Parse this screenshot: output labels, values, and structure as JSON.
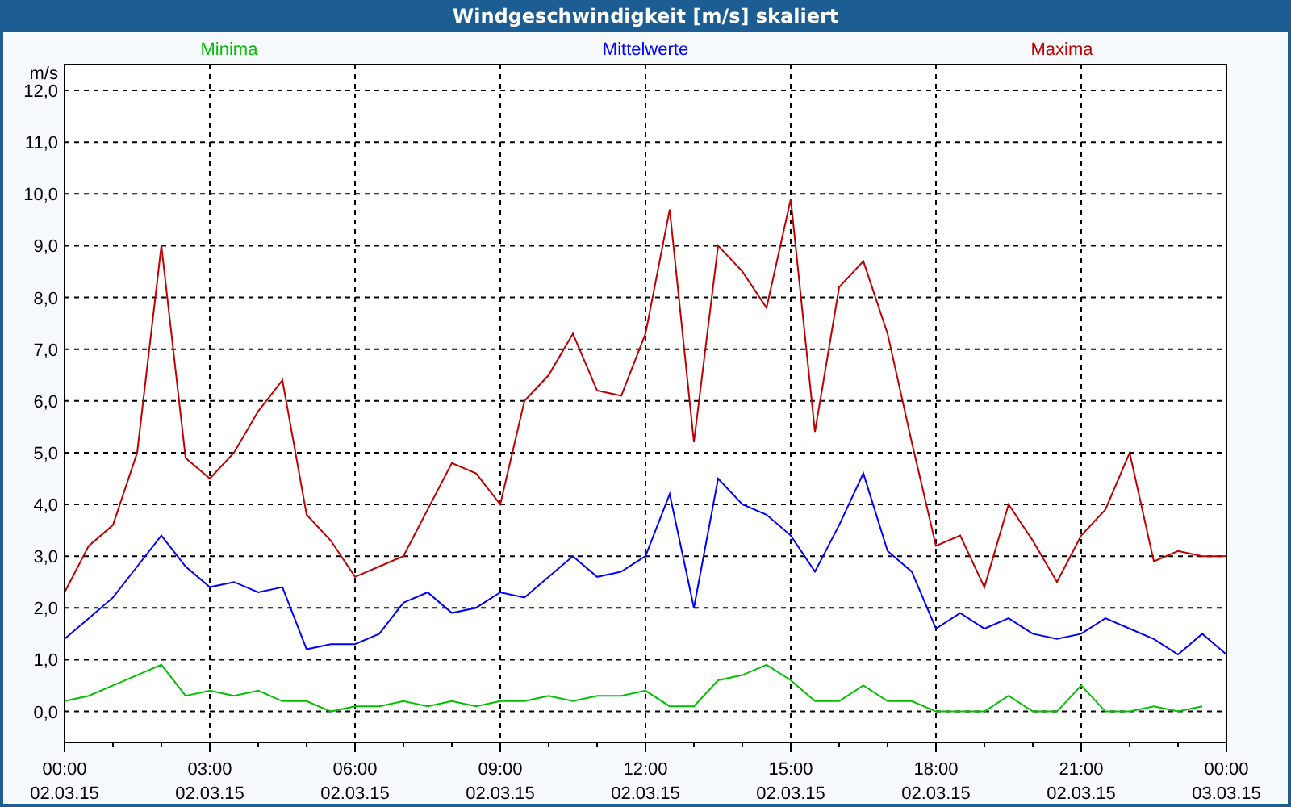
{
  "window": {
    "title": "Windgeschwindigkeit [m/s] skaliert"
  },
  "chart": {
    "unit_label": "m/s",
    "date_labels": [
      "02.03.15",
      "02.03.15",
      "02.03.15",
      "02.03.15",
      "02.03.15",
      "02.03.15",
      "02.03.15",
      "02.03.15",
      "03.03.15"
    ],
    "chart_data": {
      "type": "line",
      "grid": true,
      "xlim": [
        0,
        24
      ],
      "ylim": [
        -0.6,
        12.5
      ],
      "xticks": [
        {
          "value": 0,
          "label": "00:00"
        },
        {
          "value": 3,
          "label": "03:00"
        },
        {
          "value": 6,
          "label": "06:00"
        },
        {
          "value": 9,
          "label": "09:00"
        },
        {
          "value": 12,
          "label": "12:00"
        },
        {
          "value": 15,
          "label": "15:00"
        },
        {
          "value": 18,
          "label": "18:00"
        },
        {
          "value": 21,
          "label": "21:00"
        },
        {
          "value": 24,
          "label": "00:00"
        }
      ],
      "yticks": [
        {
          "value": 0,
          "label": "0,0"
        },
        {
          "value": 1,
          "label": "1,0"
        },
        {
          "value": 2,
          "label": "2,0"
        },
        {
          "value": 3,
          "label": "3,0"
        },
        {
          "value": 4,
          "label": "4,0"
        },
        {
          "value": 5,
          "label": "5,0"
        },
        {
          "value": 6,
          "label": "6,0"
        },
        {
          "value": 7,
          "label": "7,0"
        },
        {
          "value": 8,
          "label": "8,0"
        },
        {
          "value": 9,
          "label": "9,0"
        },
        {
          "value": 10,
          "label": "10,0"
        },
        {
          "value": 11,
          "label": "11,0"
        },
        {
          "value": 12,
          "label": "12,0"
        }
      ],
      "x": [
        0,
        0.5,
        1,
        1.5,
        2,
        2.5,
        3,
        3.5,
        4,
        4.5,
        5,
        5.5,
        6,
        6.5,
        7,
        7.5,
        8,
        8.5,
        9,
        9.5,
        10,
        10.5,
        11,
        11.5,
        12,
        12.5,
        13,
        13.5,
        14,
        14.5,
        15,
        15.5,
        16,
        16.5,
        17,
        17.5,
        18,
        18.5,
        19,
        19.5,
        20,
        20.5,
        21,
        21.5,
        22,
        22.5,
        23,
        23.5,
        24
      ],
      "series": [
        {
          "name": "Minima",
          "color": "#00c000",
          "values": [
            0.2,
            0.3,
            0.5,
            0.7,
            0.9,
            0.3,
            0.4,
            0.3,
            0.4,
            0.2,
            0.2,
            0.0,
            0.1,
            0.1,
            0.2,
            0.1,
            0.2,
            0.1,
            0.2,
            0.2,
            0.3,
            0.2,
            0.3,
            0.3,
            0.4,
            0.1,
            0.1,
            0.6,
            0.7,
            0.9,
            0.6,
            0.2,
            0.2,
            0.5,
            0.2,
            0.2,
            0.0,
            0.0,
            0.0,
            0.3,
            0.0,
            0.0,
            0.5,
            0.0,
            0.0,
            0.1,
            0.0,
            0.1,
            null
          ]
        },
        {
          "name": "Mittelwerte",
          "color": "#0000ff",
          "values": [
            1.4,
            1.8,
            2.2,
            2.8,
            3.4,
            2.8,
            2.4,
            2.5,
            2.3,
            2.4,
            1.2,
            1.3,
            1.3,
            1.5,
            2.1,
            2.3,
            1.9,
            2.0,
            2.3,
            2.2,
            2.6,
            3.0,
            2.6,
            2.7,
            3.0,
            4.2,
            2.0,
            4.5,
            4.0,
            3.8,
            3.4,
            2.7,
            3.6,
            4.6,
            3.1,
            2.7,
            1.6,
            1.9,
            1.6,
            1.8,
            1.5,
            1.4,
            1.5,
            1.8,
            1.6,
            1.4,
            1.1,
            1.5,
            1.1
          ]
        },
        {
          "name": "Maxima",
          "color": "#c00000",
          "values": [
            2.3,
            3.2,
            3.6,
            5.0,
            9.0,
            4.9,
            4.5,
            5.0,
            5.8,
            6.4,
            3.8,
            3.3,
            2.6,
            2.8,
            3.0,
            3.9,
            4.8,
            4.6,
            4.0,
            6.0,
            6.5,
            7.3,
            6.2,
            6.1,
            7.3,
            9.7,
            5.2,
            9.0,
            8.5,
            7.8,
            9.9,
            5.4,
            8.2,
            8.7,
            7.3,
            5.2,
            3.2,
            3.4,
            2.4,
            4.0,
            3.3,
            2.5,
            3.4,
            3.9,
            5.0,
            2.9,
            3.1,
            3.0,
            3.0
          ]
        }
      ]
    }
  }
}
